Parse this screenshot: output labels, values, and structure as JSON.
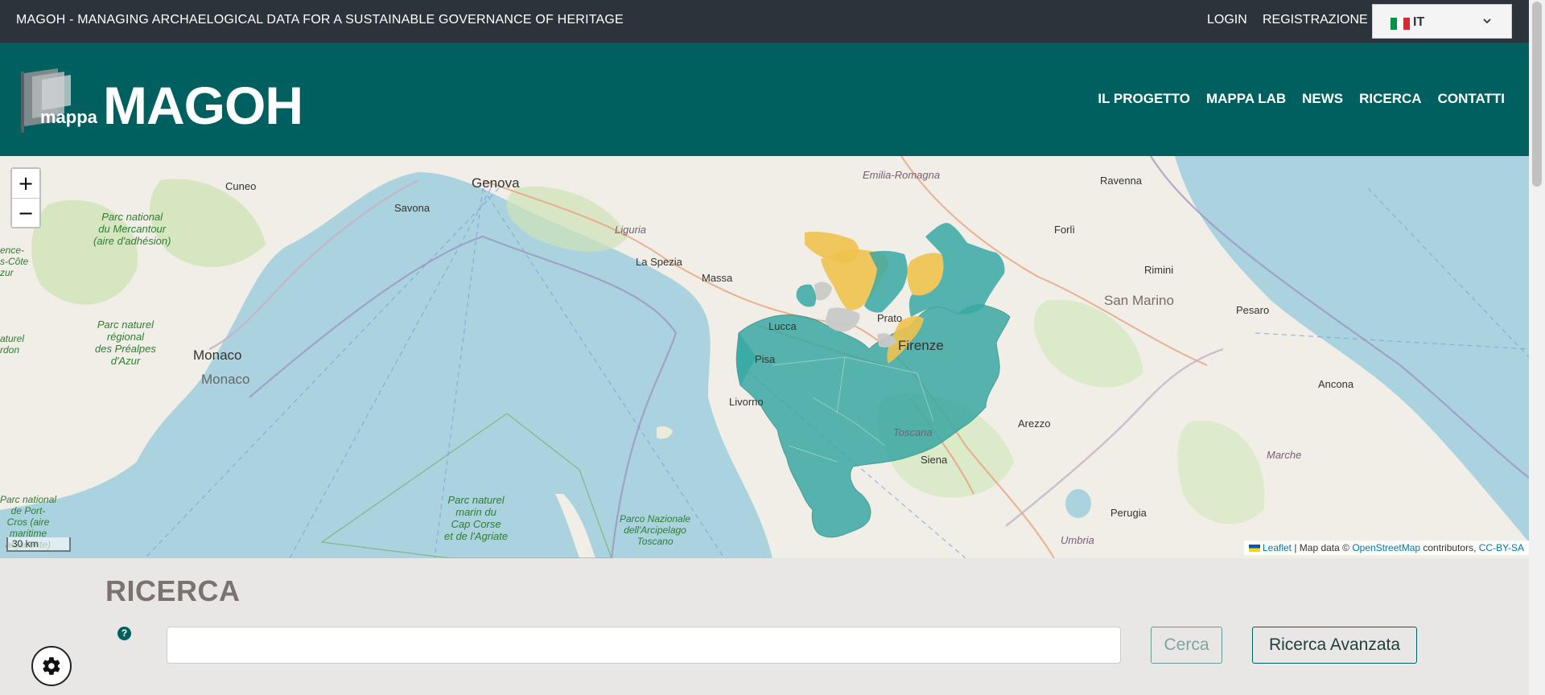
{
  "topbar": {
    "site_name": "MAGOH - MANAGING ARCHAELOGICAL DATA FOR A SUSTAINABLE GOVERNANCE OF HERITAGE",
    "login": "LOGIN",
    "register": "REGISTRAZIONE",
    "language": {
      "selected": "IT",
      "flag_icon": "italy-flag-icon"
    }
  },
  "header": {
    "logo_small": "mappa",
    "logo_title": "MAGOH",
    "nav": [
      "IL PROGETTO",
      "MAPPA LAB",
      "NEWS",
      "RICERCA",
      "CONTATTI"
    ]
  },
  "map": {
    "zoom_in": "+",
    "zoom_out": "−",
    "scale": "30 km",
    "attribution": {
      "leaflet": "Leaflet",
      "sep": " | Map data © ",
      "osm": "OpenStreetMap",
      "contributors": " contributors, ",
      "license": "CC-BY-SA"
    },
    "labels": {
      "genova": "Genova",
      "cuneo": "Cuneo",
      "savona": "Savona",
      "monaco1": "Monaco",
      "monaco2": "Monaco",
      "la_spezia": "La Spezia",
      "massa": "Massa",
      "lucca": "Lucca",
      "pisa": "Pisa",
      "livorno": "Livorno",
      "prato": "Prato",
      "firenze": "Firenze",
      "siena": "Siena",
      "arezzo": "Arezzo",
      "perugia": "Perugia",
      "forli": "Forlì",
      "ravenna": "Ravenna",
      "rimini": "Rimini",
      "san_marino": "San Marino",
      "pesaro": "Pesaro",
      "ancona": "Ancona",
      "marche": "Marche",
      "umbria": "Umbria",
      "toscana": "Toscana",
      "emilia": "Emilia-Romagna",
      "liguria": "Liguria",
      "parc_mercantour": "Parc national\ndu Mercantour\n(aire d'adhésion)",
      "parc_prealpes": "Parc naturel\nrégional\ndes Préalpes\nd'Azur",
      "parc_corse": "Parc naturel\nmarin du\nCap Corse\net de l'Agriate",
      "parco_arcipelago": "Parco Nazionale\ndell'Arcipelago\nToscano",
      "parc_port_cros": "Parc national\nde Port-\nCros (aire\nmaritime\nadjacente)",
      "cote": "ence-\ns-Côte\nzur",
      "ordon": "aturel\nrdon"
    },
    "colors": {
      "teal": "#3aa8a4",
      "yellow": "#f0c24e",
      "grey": "#c8c8c8",
      "sea": "#aad3df",
      "land": "#f0eee6"
    }
  },
  "search": {
    "title": "RICERCA",
    "help": "?",
    "input_value": "",
    "placeholder": "",
    "search_btn": "Cerca",
    "advanced_btn": "Ricerca Avanzata"
  },
  "settings": {
    "icon": "gear-icon"
  }
}
